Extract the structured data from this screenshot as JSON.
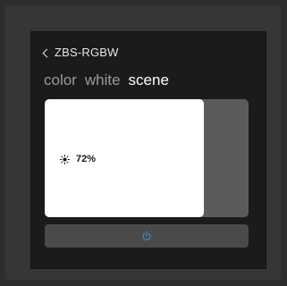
{
  "header": {
    "back_label": "ZBS-RGBW"
  },
  "tabs": [
    {
      "label": "color",
      "active": false
    },
    {
      "label": "white",
      "active": false
    },
    {
      "label": "scene",
      "active": true
    }
  ],
  "brightness": {
    "value_label": "72%",
    "level": 0.78,
    "icon": "sun-icon"
  },
  "power": {
    "icon": "power-icon",
    "color": "#3a8fd6"
  },
  "colors": {
    "fill": "#ffffff",
    "track": "#5c5a5b",
    "panel": "#1c1a1b"
  }
}
